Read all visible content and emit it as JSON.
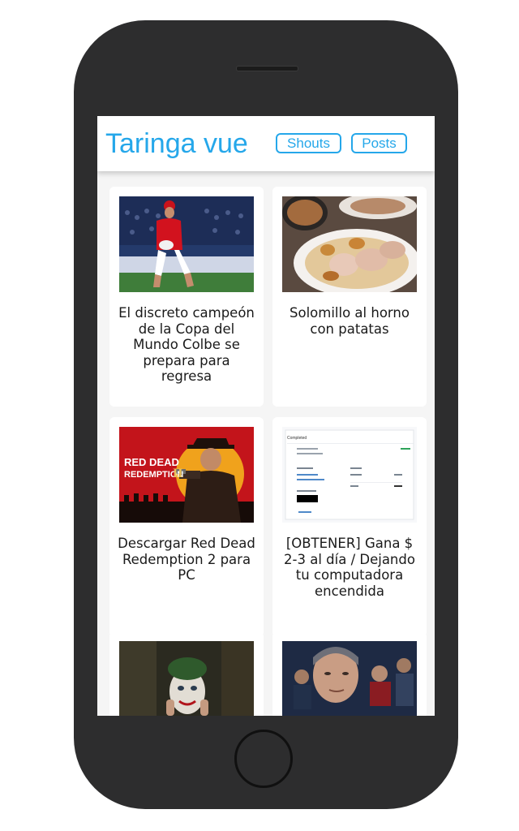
{
  "app": {
    "brand": "Taringa vue",
    "nav": [
      {
        "label": "Shouts"
      },
      {
        "label": "Posts"
      }
    ]
  },
  "posts": [
    {
      "title": "El discreto campeón de la Copa del Mundo Colbe se prepara para regresa",
      "image": "rugby-player-photo"
    },
    {
      "title": "Solomillo al horno con patatas",
      "image": "roast-pork-plate-photo"
    },
    {
      "title": "Descargar Red Dead Redemption 2 para PC",
      "image": "red-dead-redemption-cover"
    },
    {
      "title": "[OBTENER] Gana $ 2-3 al día / Dejando tu computadora encendida",
      "image": "payment-screenshot",
      "screenshot": {
        "heading": "Completed"
      }
    },
    {
      "title": "",
      "image": "joker-movie-still"
    },
    {
      "title": "",
      "image": "man-in-suit-photo"
    }
  ],
  "colors": {
    "accent": "#25a7ea",
    "phone_body": "#2d2d2e",
    "screen_bg": "#f5f5f5"
  }
}
